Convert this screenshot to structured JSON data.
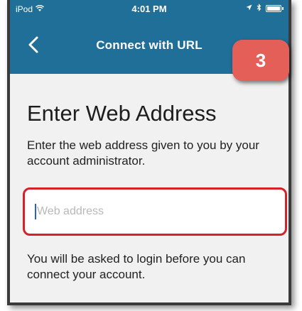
{
  "status_bar": {
    "carrier": "iPod",
    "time": "4:01 PM"
  },
  "nav": {
    "title": "Connect with URL",
    "back_glyph": "‹"
  },
  "badge": {
    "label": "3",
    "color": "#e45f58"
  },
  "content": {
    "heading": "Enter Web Address",
    "description": "Enter the web address given to you by your account administrator.",
    "input": {
      "placeholder": "Web address",
      "value": ""
    },
    "note": "You will be asked to login before you can connect your account."
  },
  "colors": {
    "nav_bar": "#1f6f99",
    "highlight_border": "#d6202a",
    "background": "#f1f1f1"
  },
  "icons": [
    "wifi-icon",
    "location-icon",
    "bluetooth-icon",
    "battery-icon",
    "back-chevron-icon"
  ]
}
